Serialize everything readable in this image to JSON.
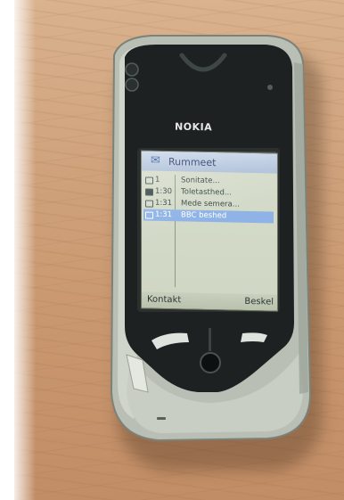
{
  "phone": {
    "brand": "NOKIA"
  },
  "screen": {
    "title": "Rummeet",
    "messages": [
      {
        "time": "1",
        "text": "Sonitate..."
      },
      {
        "time": "1:30",
        "text": "Toletasthed..."
      },
      {
        "time": "1:31",
        "text": "Mede semera..."
      },
      {
        "time": "1:31",
        "text": "BBC beshed"
      }
    ],
    "selected_index": 3,
    "softkeys": {
      "left": "Kontakt",
      "right": "Beskel"
    }
  },
  "colors": {
    "table_wood": "#cfa27c",
    "phone_body": "#bcc2b8",
    "phone_face": "#1e2222",
    "screen_bg": "#d4dac8",
    "selection": "#8fb3e6"
  }
}
